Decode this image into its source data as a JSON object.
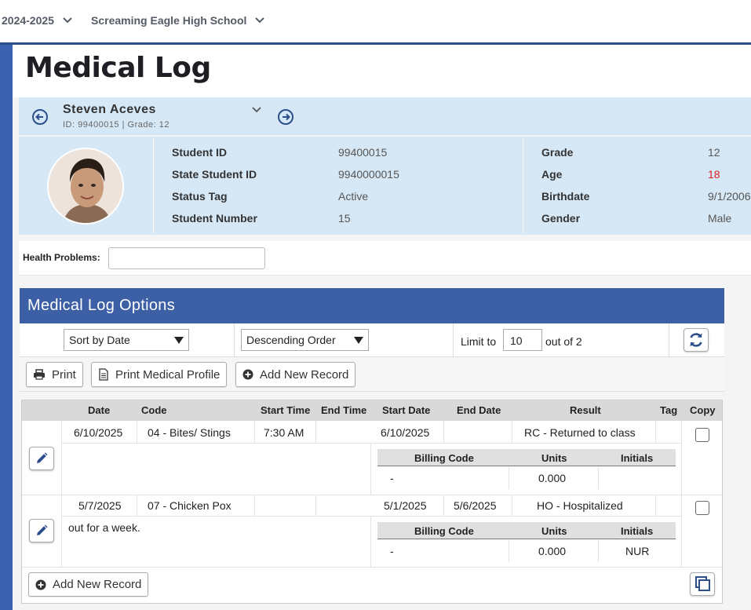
{
  "topbar": {
    "year": "2024-2025",
    "school": "Screaming Eagle High School"
  },
  "page": {
    "title": "Medical Log"
  },
  "student": {
    "name": "Steven Aceves",
    "subline": "ID: 99400015 |  Grade: 12",
    "info_left": [
      {
        "label": "Student ID",
        "value": "99400015"
      },
      {
        "label": "State Student ID",
        "value": "9940000015"
      },
      {
        "label": "Status Tag",
        "value": "Active"
      },
      {
        "label": "Student Number",
        "value": "15"
      }
    ],
    "info_right": [
      {
        "label": "Grade",
        "value": "12"
      },
      {
        "label": "Age",
        "value": "18"
      },
      {
        "label": "Birthdate",
        "value": "9/1/2006"
      },
      {
        "label": "Gender",
        "value": "Male"
      }
    ]
  },
  "health": {
    "label": "Health Problems:",
    "value": ""
  },
  "options": {
    "title": "Medical Log Options",
    "sort_by": "Sort by Date",
    "order": "Descending Order",
    "limit_label": "Limit to",
    "limit_value": "10",
    "limit_suffix": "out of 2"
  },
  "buttons": {
    "print": "Print",
    "print_profile": "Print Medical Profile",
    "add_new": "Add New Record",
    "add_new_bottom": "Add New Record"
  },
  "table": {
    "columns": [
      "Date",
      "Code",
      "Start Time",
      "End Time",
      "Start Date",
      "End Date",
      "Result",
      "Tag",
      "Copy"
    ],
    "billing_columns": [
      "Billing Code",
      "Units",
      "Initials"
    ],
    "rows": [
      {
        "date": "6/10/2025",
        "code": "04 - Bites/ Stings",
        "start_time": "7:30 AM",
        "end_time": "",
        "start_date": "6/10/2025",
        "end_date": "",
        "result": "RC - Returned to class",
        "tag": "",
        "note": "",
        "billing": {
          "code": "-",
          "units": "0.000",
          "initials": ""
        }
      },
      {
        "date": "5/7/2025",
        "code": "07 - Chicken Pox",
        "start_time": "",
        "end_time": "",
        "start_date": "5/1/2025",
        "end_date": "5/6/2025",
        "result": "HO - Hospitalized",
        "tag": "",
        "note": "out for a week.",
        "billing": {
          "code": "-",
          "units": "0.000",
          "initials": "NUR"
        }
      }
    ]
  },
  "icons": {
    "dropdown": "chevron-down-icon",
    "prev": "arrow-left-circle-icon",
    "next": "arrow-right-circle-icon",
    "refresh": "refresh-icon",
    "print": "printer-icon",
    "document": "document-icon",
    "add": "plus-circle-icon",
    "edit": "pencil-icon",
    "copy": "copy-icon"
  },
  "colors": {
    "accent": "#3c5fa5",
    "student_panel": "#d6e8f6",
    "age_alert": "#e02020",
    "left_stripe": "#3a62b0"
  }
}
